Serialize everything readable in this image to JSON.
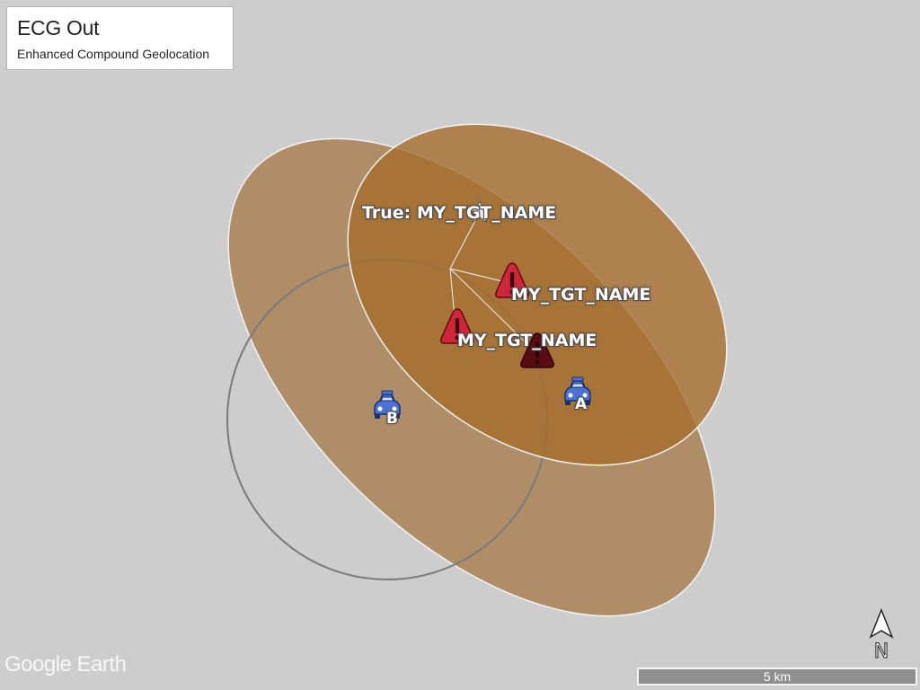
{
  "info_box": {
    "title": "ECG Out",
    "subtitle": "Enhanced Compound Geolocation"
  },
  "markers": {
    "true_target_label": "True: MY_TGT_NAME",
    "target_1_label": "MY_TGT_NAME",
    "target_2_label": "MY_TGT_NAME",
    "sensor_a_label": "A",
    "sensor_b_label": "B"
  },
  "scale": {
    "label": "5 km"
  },
  "compass": {
    "label": "N"
  },
  "brand": {
    "text": "Google Earth"
  },
  "colors": {
    "map_background": "#cdcdcd",
    "ellipse_fill": "#a66b26",
    "warning_red": "#d0263b",
    "warning_dark": "#5a0c14",
    "vehicle_blue": "#4a72d8"
  },
  "icons": {
    "true_target": "star-icon",
    "target": "warning-triangle-icon",
    "sensor": "car-icon",
    "compass": "north-arrow-icon"
  }
}
